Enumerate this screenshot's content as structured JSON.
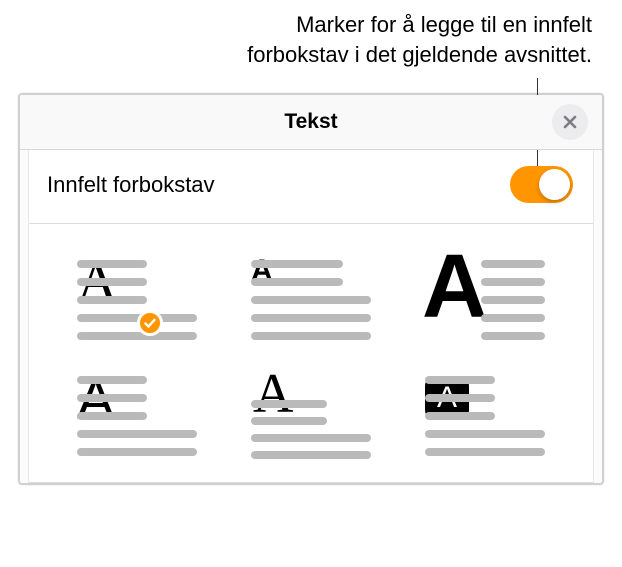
{
  "caption": {
    "line1": "Marker for å legge til en innfelt",
    "line2": "forbokstav i det gjeldende avsnittet."
  },
  "panel": {
    "title": "Tekst",
    "toggle_label": "Innfelt forbokstav",
    "toggle_on": true,
    "selected_index": 0,
    "options": [
      "dropcap-serif-3line",
      "dropcap-bold-2line",
      "dropcap-heavy-5line",
      "dropcap-sans-3line",
      "dropcap-raised-serif",
      "dropcap-reversed-box"
    ]
  }
}
